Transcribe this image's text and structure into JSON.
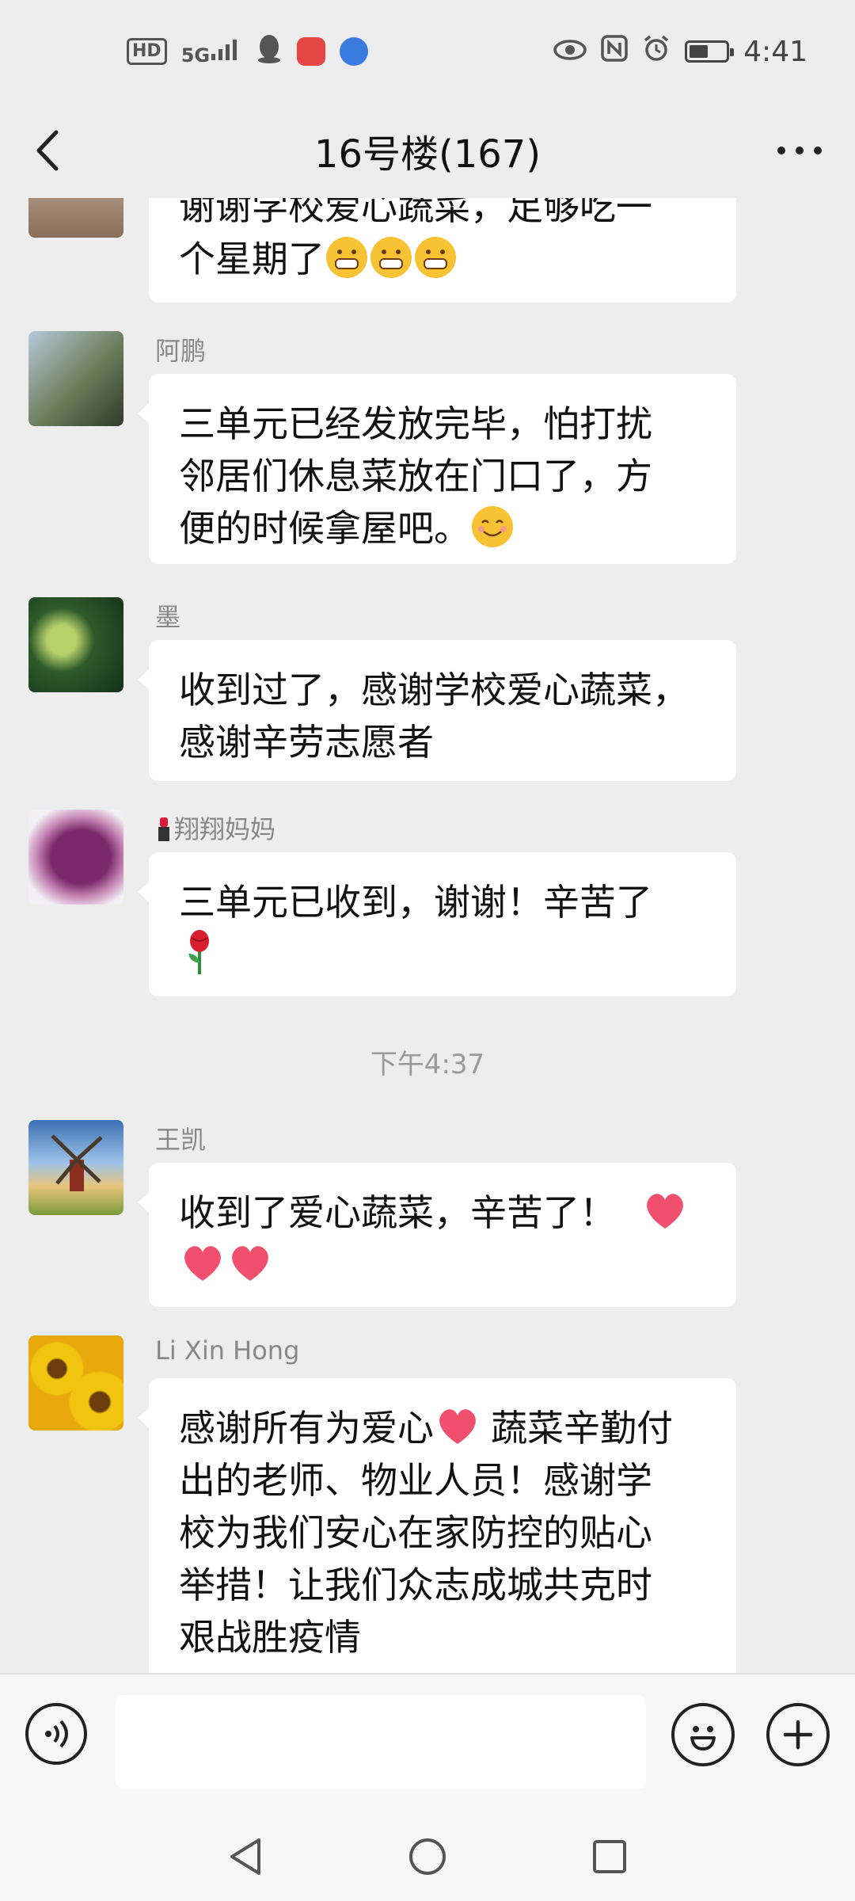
{
  "status_bar": {
    "left_badges": [
      "HD",
      "5G"
    ],
    "time": "4:41"
  },
  "header": {
    "title": "16号楼(167)"
  },
  "colors": {
    "background": "#ededed",
    "bubble": "#ffffff",
    "heart": "#f0506e",
    "emoji": "#f7c233"
  },
  "messages": [
    {
      "sender": "",
      "lines": [
        "谢谢学校爱心蔬菜，足够吃一",
        "个星期了"
      ],
      "emojis": [
        "grin-icon",
        "grin-icon",
        "grin-icon"
      ]
    },
    {
      "sender": "阿鹏",
      "lines": [
        "三单元已经发放完毕，怕打扰",
        "邻居们休息菜放在门口了，方",
        "便的时候拿屋吧。"
      ],
      "emojis": [
        "smile-icon"
      ]
    },
    {
      "sender": "墨",
      "lines": [
        "收到过了，感谢学校爱心蔬菜，",
        "感谢辛劳志愿者"
      ]
    },
    {
      "sender": "翔翔妈妈",
      "sender_icon": "lipstick-icon",
      "lines": [
        "三单元已收到，谢谢！辛苦了"
      ],
      "emojis": [
        "rose-icon"
      ]
    },
    {
      "sender": "王凯",
      "lines": [
        "收到了爱心蔬菜，辛苦了！"
      ],
      "emojis": [
        "heart-icon",
        "heart-icon",
        "heart-icon"
      ]
    },
    {
      "sender": "Li Xin Hong",
      "lines": [
        "感谢所有为爱心",
        "蔬菜辛勤付",
        "出的老师、物业人员！感谢学",
        "校为我们安心在家防控的贴心",
        "举措！让我们众志成城共克时",
        "艰战胜疫情"
      ],
      "emojis": [
        "heart-icon"
      ]
    }
  ],
  "timestamp": "下午4:37",
  "input": {
    "placeholder": ""
  }
}
